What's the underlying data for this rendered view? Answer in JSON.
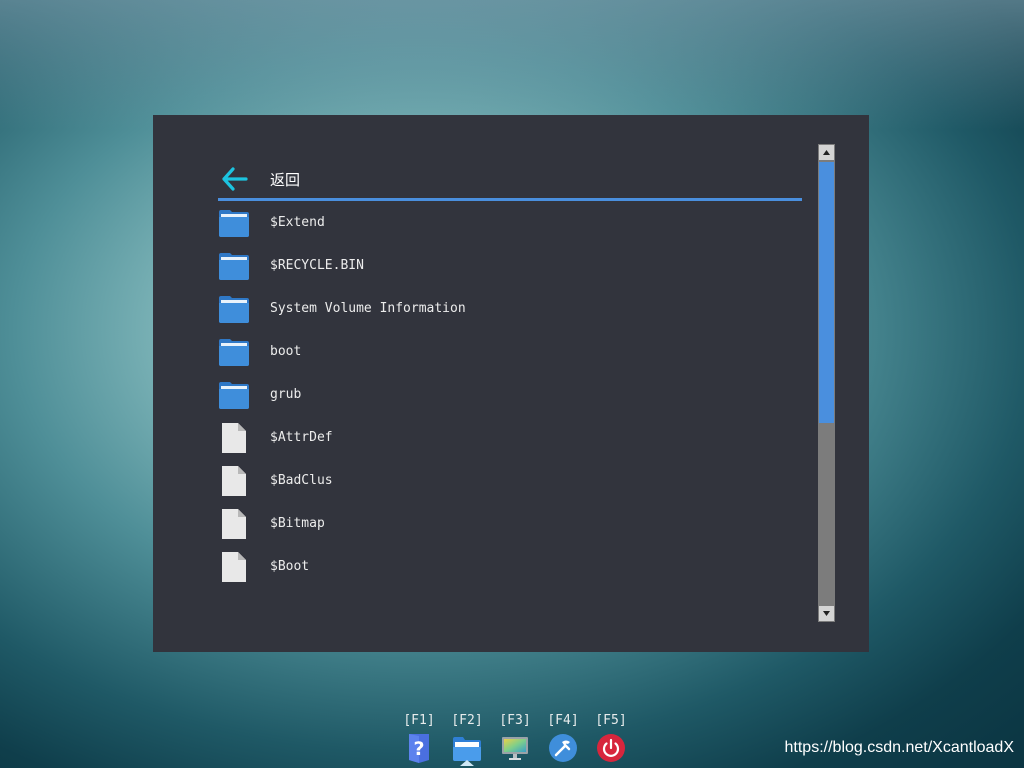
{
  "colors": {
    "window_bg": "#32343d",
    "accent_blue": "#4a8fde",
    "back_arrow": "#1cc4e0",
    "folder": "#3f8edb",
    "file": "#e8e8e8",
    "scrollbar_track": "#7c7c7c"
  },
  "window": {
    "back": {
      "icon": "arrow-left-icon",
      "label": "返回"
    },
    "items": [
      {
        "type": "folder",
        "icon": "folder-icon",
        "name": "$Extend"
      },
      {
        "type": "folder",
        "icon": "folder-icon",
        "name": "$RECYCLE.BIN"
      },
      {
        "type": "folder",
        "icon": "folder-icon",
        "name": "System Volume Information"
      },
      {
        "type": "folder",
        "icon": "folder-icon",
        "name": "boot"
      },
      {
        "type": "folder",
        "icon": "folder-icon",
        "name": "grub"
      },
      {
        "type": "file",
        "icon": "file-icon",
        "name": "$AttrDef"
      },
      {
        "type": "file",
        "icon": "file-icon",
        "name": "$BadClus"
      },
      {
        "type": "file",
        "icon": "file-icon",
        "name": "$Bitmap"
      },
      {
        "type": "file",
        "icon": "file-icon",
        "name": "$Boot"
      }
    ],
    "scrollbar": {
      "position": 0,
      "visible_fraction": 0.59
    }
  },
  "taskbar": {
    "active_index": 1,
    "items": [
      {
        "key": "[F1]",
        "icon": "help-icon"
      },
      {
        "key": "[F2]",
        "icon": "file-manager-icon"
      },
      {
        "key": "[F3]",
        "icon": "monitor-icon"
      },
      {
        "key": "[F4]",
        "icon": "tools-icon"
      },
      {
        "key": "[F5]",
        "icon": "power-icon"
      }
    ]
  },
  "watermark": "https://blog.csdn.net/XcantloadX"
}
